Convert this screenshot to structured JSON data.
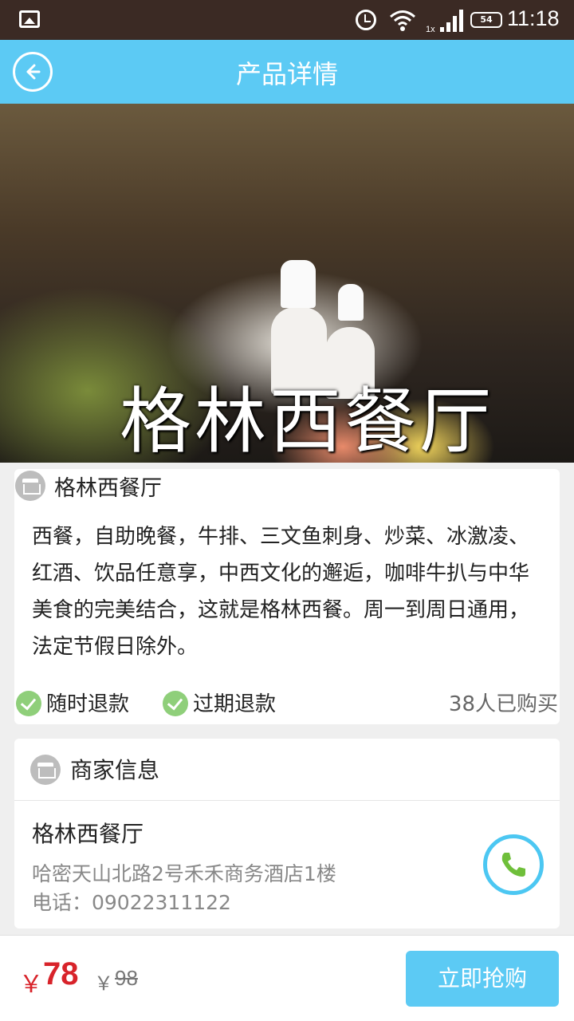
{
  "status_bar": {
    "time": "11:18",
    "battery": "54",
    "icons": [
      "picture-icon",
      "alarm-icon",
      "wifi-icon",
      "signal-icon",
      "battery-icon"
    ]
  },
  "header": {
    "title": "产品详情",
    "back_icon": "back-arrow-icon"
  },
  "hero": {
    "title": "格林西餐厅"
  },
  "product": {
    "name": "格林西餐厅",
    "description": "西餐，自助晚餐，牛排、三文鱼刺身、炒菜、冰激凌、红酒、饮品任意享，中西文化的邂逅，咖啡牛扒与中华美食的完美结合，这就是格林西餐。周一到周日通用，法定节假日除外。",
    "refund_anytime": "随时退款",
    "refund_expired": "过期退款",
    "sold_count": "38人已购买"
  },
  "merchant": {
    "section_title": "商家信息",
    "name": "格林西餐厅",
    "address": "哈密天山北路2号禾禾商务酒店1楼",
    "phone": "电话：09022311122"
  },
  "purchase": {
    "currency": "￥",
    "price": "78",
    "original_currency": "￥",
    "original_price": "98",
    "buy_label": "立即抢购"
  },
  "colors": {
    "primary": "#5ccaf4",
    "price": "#d8232a",
    "check": "#8fcf7a",
    "status_bar": "#3b2a24"
  }
}
